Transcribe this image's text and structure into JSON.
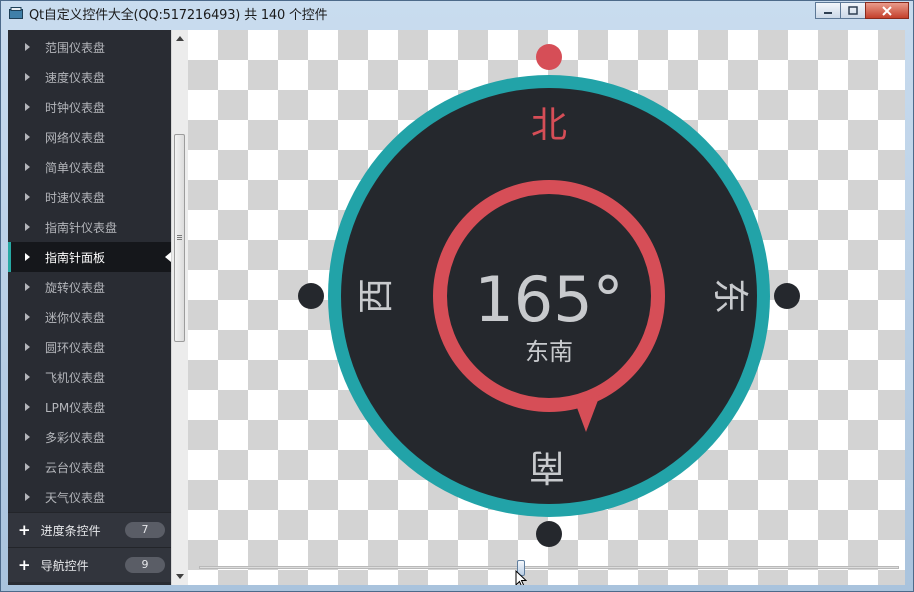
{
  "window": {
    "title": "Qt自定义控件大全(QQ:517216493) 共 140 个控件"
  },
  "sidebar": {
    "items": [
      {
        "label": "范围仪表盘"
      },
      {
        "label": "速度仪表盘"
      },
      {
        "label": "时钟仪表盘"
      },
      {
        "label": "网络仪表盘"
      },
      {
        "label": "简单仪表盘"
      },
      {
        "label": "时速仪表盘"
      },
      {
        "label": "指南针仪表盘"
      },
      {
        "label": "指南针面板",
        "selected": true
      },
      {
        "label": "旋转仪表盘"
      },
      {
        "label": "迷你仪表盘"
      },
      {
        "label": "圆环仪表盘"
      },
      {
        "label": "飞机仪表盘"
      },
      {
        "label": "LPM仪表盘"
      },
      {
        "label": "多彩仪表盘"
      },
      {
        "label": "云台仪表盘"
      },
      {
        "label": "天气仪表盘"
      }
    ],
    "groups": [
      {
        "label": "进度条控件",
        "count": "7"
      },
      {
        "label": "导航控件",
        "count": "9"
      }
    ]
  },
  "compass": {
    "value": "165°",
    "direction": "东南",
    "north": "北",
    "south": "南",
    "east": "东",
    "west": "西",
    "colors": {
      "ring": "#22a3a8",
      "face": "#25282d",
      "pointer": "#d64e57",
      "text": "#c8cacd",
      "north_text": "#d64e57"
    }
  },
  "slider": {
    "value_fraction": 0.46
  }
}
